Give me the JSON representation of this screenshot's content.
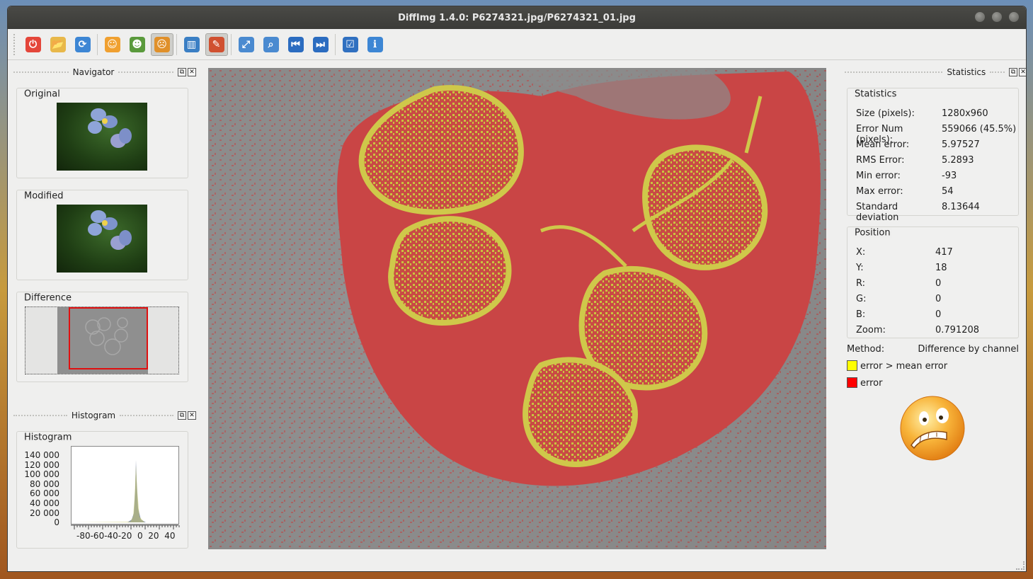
{
  "window": {
    "title": "DiffImg 1.4.0: P6274321.jpg/P6274321_01.jpg"
  },
  "toolbar": {
    "buttons": [
      {
        "name": "quit-icon",
        "color": "#e4463a",
        "glyph": "⏻"
      },
      {
        "name": "open-folder-icon",
        "color": "#e8b84a",
        "glyph": "📂"
      },
      {
        "name": "refresh-icon",
        "color": "#3d86d4",
        "glyph": "⟳"
      },
      {
        "name": "show-original-icon",
        "color": "#f0a030",
        "glyph": "☺"
      },
      {
        "name": "show-modified-icon",
        "color": "#5a9a3c",
        "glyph": "☻"
      },
      {
        "name": "show-difference-icon",
        "color": "#e0902a",
        "glyph": "☹"
      },
      {
        "name": "dual-panel-icon",
        "color": "#3b7fc4",
        "glyph": "▥"
      },
      {
        "name": "save-difference-icon",
        "color": "#d05030",
        "glyph": "✎"
      },
      {
        "name": "fit-to-window-icon",
        "color": "#4a8ad0",
        "glyph": "⤢"
      },
      {
        "name": "zoom-original-icon",
        "color": "#4a8ad0",
        "glyph": "⌕"
      },
      {
        "name": "previous-icon",
        "color": "#2b6cc0",
        "glyph": "⏮"
      },
      {
        "name": "next-icon",
        "color": "#2b6cc0",
        "glyph": "⏭"
      },
      {
        "name": "preferences-icon",
        "color": "#3070c0",
        "glyph": "☑"
      },
      {
        "name": "about-icon",
        "color": "#3d86d4",
        "glyph": "ℹ"
      }
    ]
  },
  "navigator": {
    "dock_title": "Navigator",
    "original_label": "Original",
    "modified_label": "Modified",
    "difference_label": "Difference"
  },
  "histogram": {
    "dock_title": "Histogram",
    "group_label": "Histogram",
    "y_ticks": [
      "140 000",
      "120 000",
      "100 000",
      "80 000",
      "60 000",
      "40 000",
      "20 000",
      "0"
    ],
    "x_ticks": "-80-60-40-20  0  20  40"
  },
  "statistics": {
    "dock_title": "Statistics",
    "group_label": "Statistics",
    "rows": [
      {
        "key": "Size (pixels):",
        "value": "1280x960"
      },
      {
        "key": "Error Num (pixels):",
        "value": "559066 (45.5%)"
      },
      {
        "key": "Mean error:",
        "value": "5.97527"
      },
      {
        "key": "RMS Error:",
        "value": "5.2893"
      },
      {
        "key": "Min error:",
        "value": "-93"
      },
      {
        "key": "Max error:",
        "value": "54"
      },
      {
        "key": "Standard deviation",
        "value": "8.13644"
      }
    ]
  },
  "position": {
    "group_label": "Position",
    "rows": [
      {
        "key": "X:",
        "value": "417"
      },
      {
        "key": "Y:",
        "value": "18"
      },
      {
        "key": "R:",
        "value": "0"
      },
      {
        "key": "G:",
        "value": "0"
      },
      {
        "key": "B:",
        "value": "0"
      },
      {
        "key": "Zoom:",
        "value": "0.791208"
      }
    ]
  },
  "method": {
    "label": "Method:",
    "value": "Difference by channel",
    "legend": [
      {
        "label": "error > mean error",
        "color": "#ffff00"
      },
      {
        "label": "error",
        "color": "#ff0000"
      }
    ]
  }
}
